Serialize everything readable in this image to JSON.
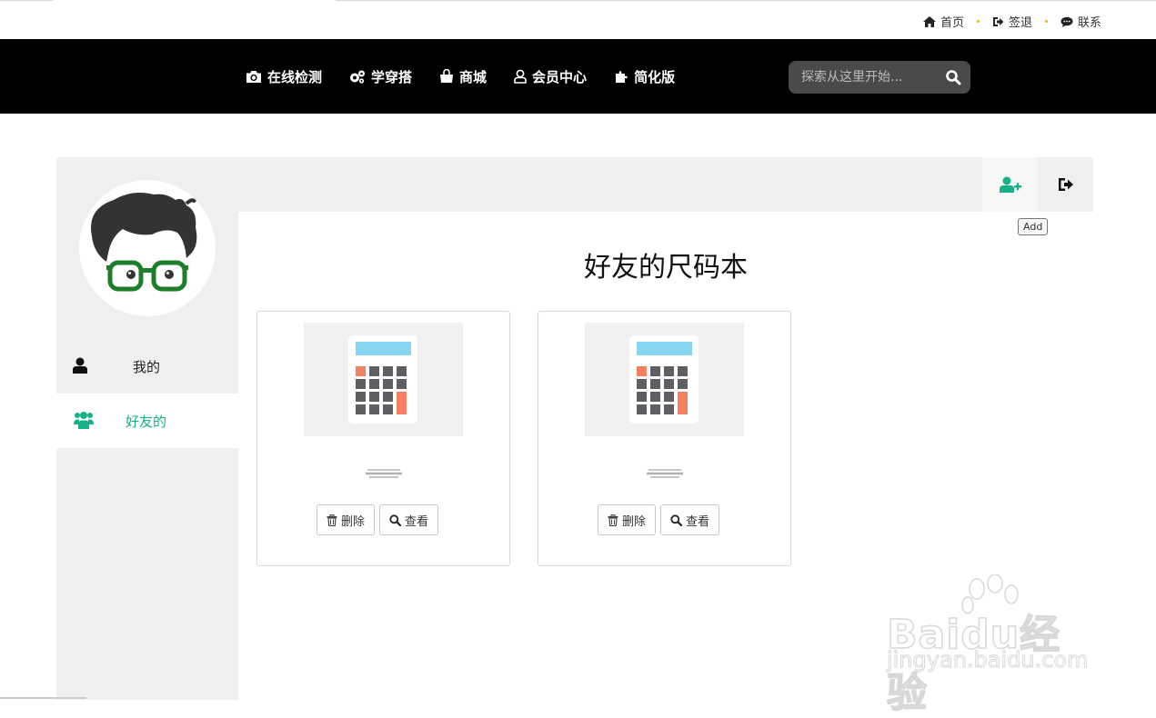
{
  "util_links": [
    {
      "label": "首页",
      "icon": "home-icon"
    },
    {
      "label": "签退",
      "icon": "sign-out-icon"
    },
    {
      "label": "联系",
      "icon": "chat-icon"
    }
  ],
  "nav": {
    "items": [
      {
        "label": "在线检测",
        "icon": "camera-icon"
      },
      {
        "label": "学穿搭",
        "icon": "gears-icon"
      },
      {
        "label": "商城",
        "icon": "shopping-bag-icon"
      },
      {
        "label": "会员中心",
        "icon": "user-icon"
      },
      {
        "label": "简化版",
        "icon": "puzzle-icon"
      }
    ],
    "search_placeholder": "探索从这里开始..."
  },
  "sidebar": {
    "items": [
      {
        "label": "我的",
        "icon": "user-icon",
        "active": false
      },
      {
        "label": "好友的",
        "icon": "users-icon",
        "active": true
      }
    ]
  },
  "tabs": {
    "add_tooltip": "Add"
  },
  "main": {
    "title": "好友的尺码本",
    "cards": [
      {
        "delete_label": "删除",
        "view_label": "查看"
      },
      {
        "delete_label": "删除",
        "view_label": "查看"
      }
    ]
  },
  "colors": {
    "accent": "#17b08a",
    "nav_bg": "#000000",
    "panel_bg": "#efefef",
    "dot": "#f3b400"
  }
}
